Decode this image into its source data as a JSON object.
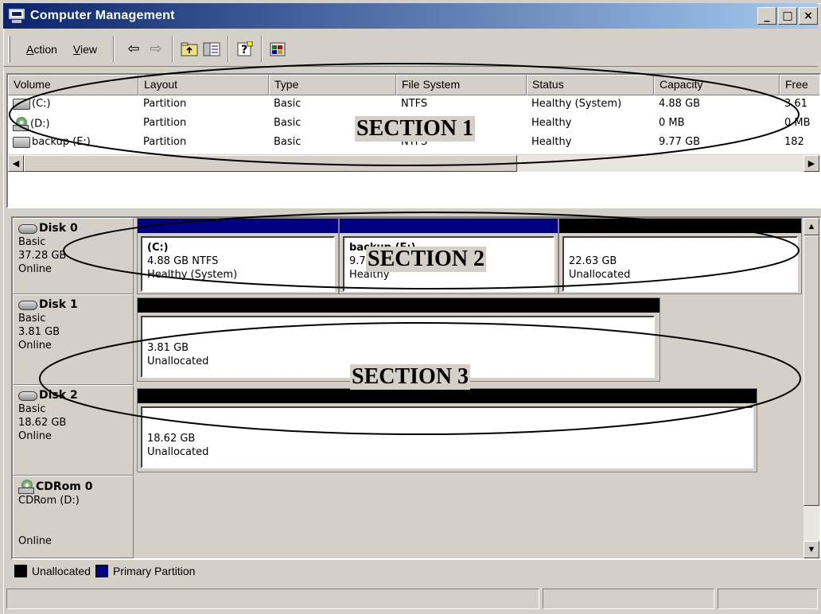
{
  "window": {
    "title": "Computer Management",
    "controls": {
      "minimize": "_",
      "maximize": "□",
      "close": "×"
    }
  },
  "toolbar": {
    "menu": [
      {
        "label_first": "A",
        "label_rest": "ction"
      },
      {
        "label_first": "V",
        "label_rest": "iew"
      }
    ],
    "icons": [
      "back-arrow-icon",
      "forward-arrow-icon",
      "up-folder-icon",
      "show-hide-tree-icon",
      "help-icon",
      "properties-icon"
    ]
  },
  "volumes": {
    "columns": [
      "Volume",
      "Layout",
      "Type",
      "File System",
      "Status",
      "Capacity",
      "Free"
    ],
    "rows": [
      {
        "icon": "hard-drive-icon",
        "volume": "(C:)",
        "layout": "Partition",
        "type": "Basic",
        "fs": "NTFS",
        "status": "Healthy (System)",
        "capacity": "4.88 GB",
        "free": "3.61"
      },
      {
        "icon": "cdrom-icon",
        "volume": "(D:)",
        "layout": "Partition",
        "type": "Basic",
        "fs": "",
        "status": "Healthy",
        "capacity": "0 MB",
        "free": "0 MB"
      },
      {
        "icon": "hard-drive-icon",
        "volume": "backup (E:)",
        "layout": "Partition",
        "type": "Basic",
        "fs": "NTFS",
        "status": "Healthy",
        "capacity": "9.77 GB",
        "free": "182"
      }
    ]
  },
  "disks": [
    {
      "name": "Disk 0",
      "kind": "Basic",
      "size": "37.28 GB",
      "state": "Online",
      "partitions": [
        {
          "title": "(C:)",
          "line1": "4.88 GB NTFS",
          "line2": "Healthy (System)",
          "kind": "primary"
        },
        {
          "title": "backup  (E:)",
          "line1": "9.77 GB NTFS",
          "line2": "Healthy",
          "kind": "primary"
        },
        {
          "title": "",
          "line1": "22.63 GB",
          "line2": "Unallocated",
          "kind": "unallocated"
        }
      ]
    },
    {
      "name": "Disk 1",
      "kind": "Basic",
      "size": "3.81 GB",
      "state": "Online",
      "partitions": [
        {
          "title": "",
          "line1": "3.81 GB",
          "line2": "Unallocated",
          "kind": "unallocated"
        }
      ]
    },
    {
      "name": "Disk 2",
      "kind": "Basic",
      "size": "18.62 GB",
      "state": "Online",
      "partitions": [
        {
          "title": "",
          "line1": "18.62 GB",
          "line2": "Unallocated",
          "kind": "unallocated"
        }
      ]
    },
    {
      "name": "CDRom 0",
      "kind": "CDRom (D:)",
      "size": "",
      "state": "Online"
    }
  ],
  "legend": [
    {
      "label": "Unallocated",
      "color": "#000000"
    },
    {
      "label": "Primary Partition",
      "color": "#000080"
    }
  ],
  "annotations": {
    "section1": "SECTION 1",
    "section2": "SECTION 2",
    "section3": "SECTION 3"
  },
  "colors": {
    "primary_partition": "#000080",
    "unallocated": "#000000",
    "title_bar": "#0a246a"
  }
}
